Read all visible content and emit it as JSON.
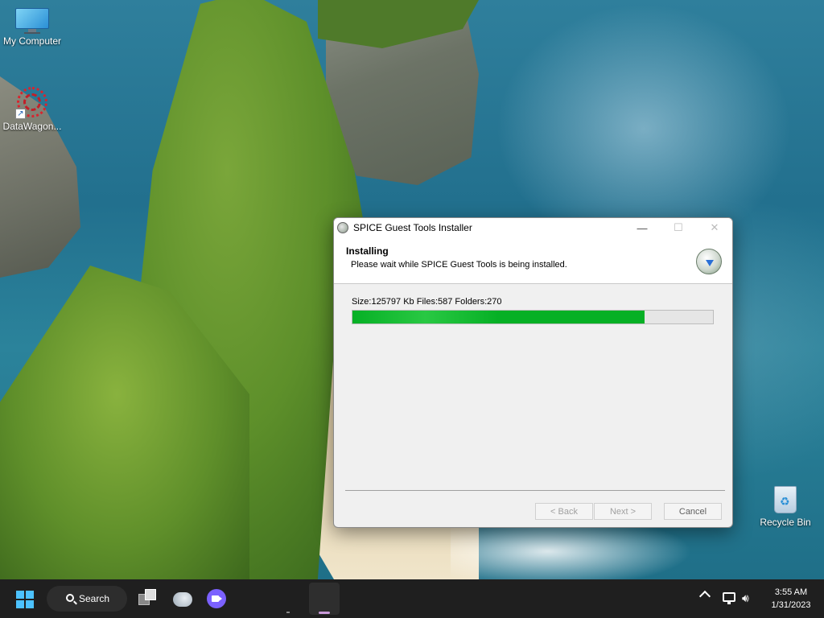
{
  "desktop": {
    "icons": [
      {
        "label": "My Computer",
        "icon": "computer-icon"
      },
      {
        "label": "DataWagon...",
        "icon": "datawagon-icon"
      },
      {
        "label": "Recycle Bin",
        "icon": "recycle-bin-icon"
      }
    ]
  },
  "installer": {
    "window_title": "SPICE Guest Tools Installer",
    "minimize_glyph": "—",
    "maximize_glyph": "☐",
    "close_glyph": "✕",
    "header_title": "Installing",
    "header_subtitle": "Please wait while SPICE Guest Tools is being installed.",
    "stats_text": "Size:125797 Kb  Files:587  Folders:270",
    "progress_fraction": 0.81,
    "progress_color": "#06b025",
    "buttons": {
      "back": "< Back",
      "next": "Next >",
      "cancel": "Cancel"
    }
  },
  "taskbar": {
    "search_label": "Search",
    "clock_time": "3:55 AM",
    "clock_date": "1/31/2023",
    "accent": "#4cc2ff"
  }
}
